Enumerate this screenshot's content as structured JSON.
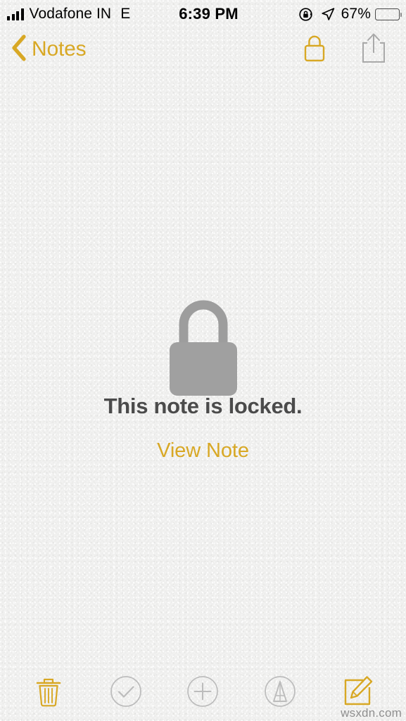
{
  "status_bar": {
    "carrier": "Vodafone IN",
    "network_type": "E",
    "time": "6:39 PM",
    "battery_percent": "67%",
    "battery_level": 67,
    "signal_bars": 4,
    "signal_bars_filled": 4,
    "icons": {
      "rotation_lock": "rotation-lock-icon",
      "location": "location-arrow-icon",
      "battery": "battery-icon",
      "signal": "signal-bars-icon"
    }
  },
  "nav_bar": {
    "back_label": "Notes",
    "back_icon": "chevron-left-icon",
    "lock_icon": "lock-icon",
    "share_icon": "share-icon"
  },
  "main": {
    "lock_graphic_icon": "padlock-icon",
    "locked_title": "This note is locked.",
    "view_note_label": "View Note"
  },
  "toolbar": {
    "items": [
      {
        "name": "delete-button",
        "icon": "trash-icon",
        "color": "#d8a825"
      },
      {
        "name": "checklist-button",
        "icon": "checkmark-circle-icon",
        "color": "#b4b4b4"
      },
      {
        "name": "add-button",
        "icon": "plus-circle-icon",
        "color": "#b4b4b4"
      },
      {
        "name": "markup-button",
        "icon": "markup-pen-circle-icon",
        "color": "#b4b4b4"
      },
      {
        "name": "compose-button",
        "icon": "compose-icon",
        "color": "#d8a825"
      }
    ]
  },
  "watermark": {
    "text": "wsxdn.com"
  },
  "colors": {
    "accent_gold": "#d8a825",
    "text_dark": "#4b4b4b",
    "icon_gray": "#b4b4b4",
    "lock_gray": "#9a9a9a",
    "background": "#f3f3f2"
  }
}
